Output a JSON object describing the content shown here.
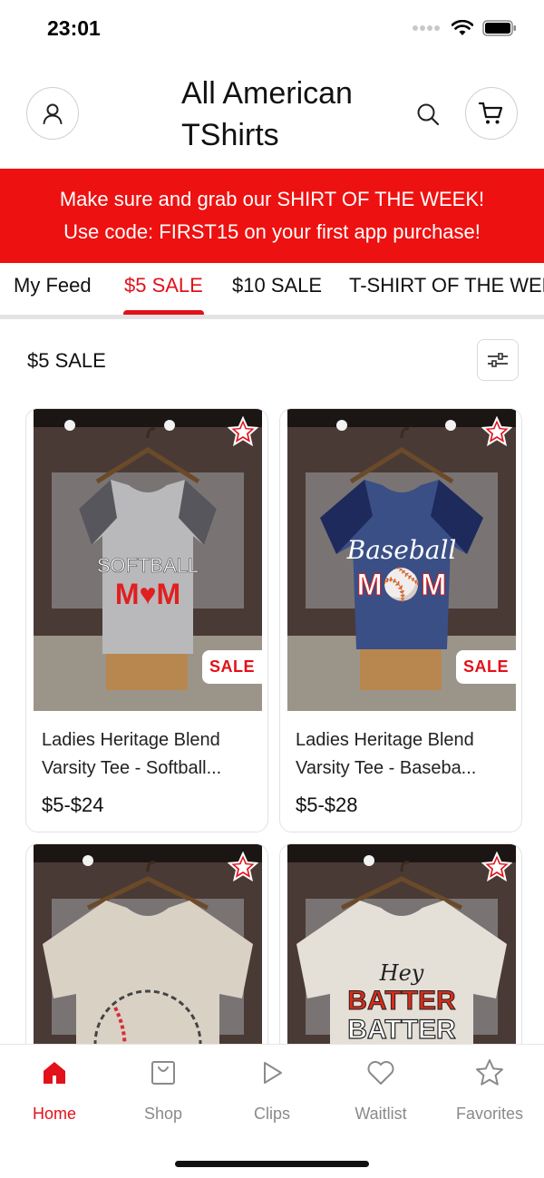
{
  "status_bar": {
    "time": "23:01"
  },
  "header": {
    "title_line1": "All American",
    "title_line2": "TShirts"
  },
  "promo": {
    "line1": "Make sure and grab our SHIRT OF THE WEEK!",
    "line2": "Use code: FIRST15 on your first app purchase!"
  },
  "tabs": [
    {
      "label": "My Feed"
    },
    {
      "label": "$5 SALE"
    },
    {
      "label": "$10 SALE"
    },
    {
      "label": "T-SHIRT OF THE WEEK"
    }
  ],
  "section": {
    "title": "$5 SALE"
  },
  "products": [
    {
      "name_line1": "Ladies Heritage Blend",
      "name_line2": "Varsity Tee - Softball...",
      "price": "$5-$24",
      "badge": "SALE",
      "shirt_text": "SOFTBALL",
      "shirt_text2": "MOM",
      "shirt_color": "#b9b9bb",
      "sleeve_color": "#56565c"
    },
    {
      "name_line1": "Ladies Heritage Blend",
      "name_line2": "Varsity Tee - Baseba...",
      "price": "$5-$28",
      "badge": "SALE",
      "shirt_text": "Baseball",
      "shirt_text2": "MOM",
      "shirt_color": "#3a4f86",
      "sleeve_color": "#1e2a5c"
    },
    {
      "shirt_color": "#d9d1c4"
    },
    {
      "shirt_text": "Hey",
      "shirt_text2": "BATTER",
      "shirt_text3": "BATTER",
      "shirt_color": "#e4e0d8"
    }
  ],
  "bottom_nav": [
    {
      "label": "Home"
    },
    {
      "label": "Shop"
    },
    {
      "label": "Clips"
    },
    {
      "label": "Waitlist"
    },
    {
      "label": "Favorites"
    }
  ],
  "colors": {
    "accent": "#e2111a",
    "promo_bg": "#ee1111",
    "muted": "#8a8a8a"
  }
}
